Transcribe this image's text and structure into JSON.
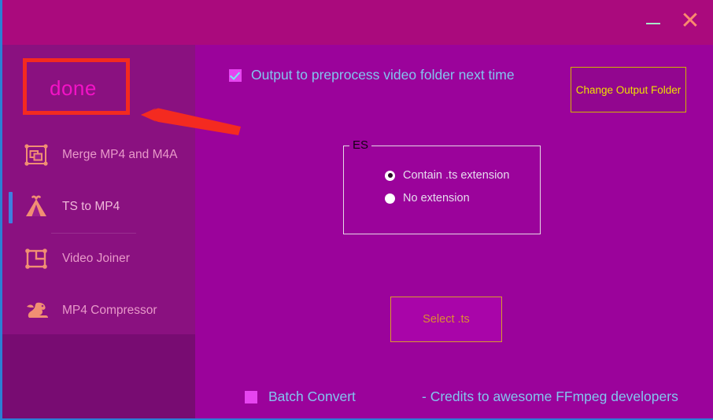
{
  "window": {
    "title_bar": {
      "minimize_label": "–",
      "close_label": "✕",
      "minimize_icon": "minimize-icon",
      "close_icon": "close-icon"
    }
  },
  "sidebar": {
    "done_label": "done",
    "items": [
      {
        "label": "Merge MP4 and M4A",
        "icon": "frame-layers-icon",
        "active": false
      },
      {
        "label": "TS to MP4",
        "icon": "tent-icon",
        "active": true
      },
      {
        "label": "Video Joiner",
        "icon": "crop-frame-icon",
        "active": false
      },
      {
        "label": "MP4 Compressor",
        "icon": "dragon-icon",
        "active": false
      }
    ]
  },
  "content": {
    "output_checkbox": {
      "label": "Output to preprocess video folder next time",
      "checked": true
    },
    "change_output_folder_button": "Change Output\nFolder",
    "extension_group": {
      "legend": "ES",
      "options": [
        {
          "label": "Contain .ts extension",
          "selected": true
        },
        {
          "label": "No extension",
          "selected": false
        }
      ]
    },
    "select_ts_button": "Select .ts",
    "batch_convert": {
      "label": "Batch Convert",
      "checked": false
    },
    "credits": "- Credits to awesome FFmpeg developers"
  },
  "annotation": {
    "highlight_color": "#f42a20",
    "arrow_color": "#f42a20"
  },
  "colors": {
    "title_bar": "#aa0a7d",
    "sidebar": "#8a1180",
    "sidebar_bottom": "#780c72",
    "content": "#9b039b",
    "accent_blue": "#3e7fe0",
    "label_blue": "#83c5ef",
    "yellow": "#f0e000",
    "orange": "#dc8b33",
    "done_pink": "#f312c6"
  }
}
